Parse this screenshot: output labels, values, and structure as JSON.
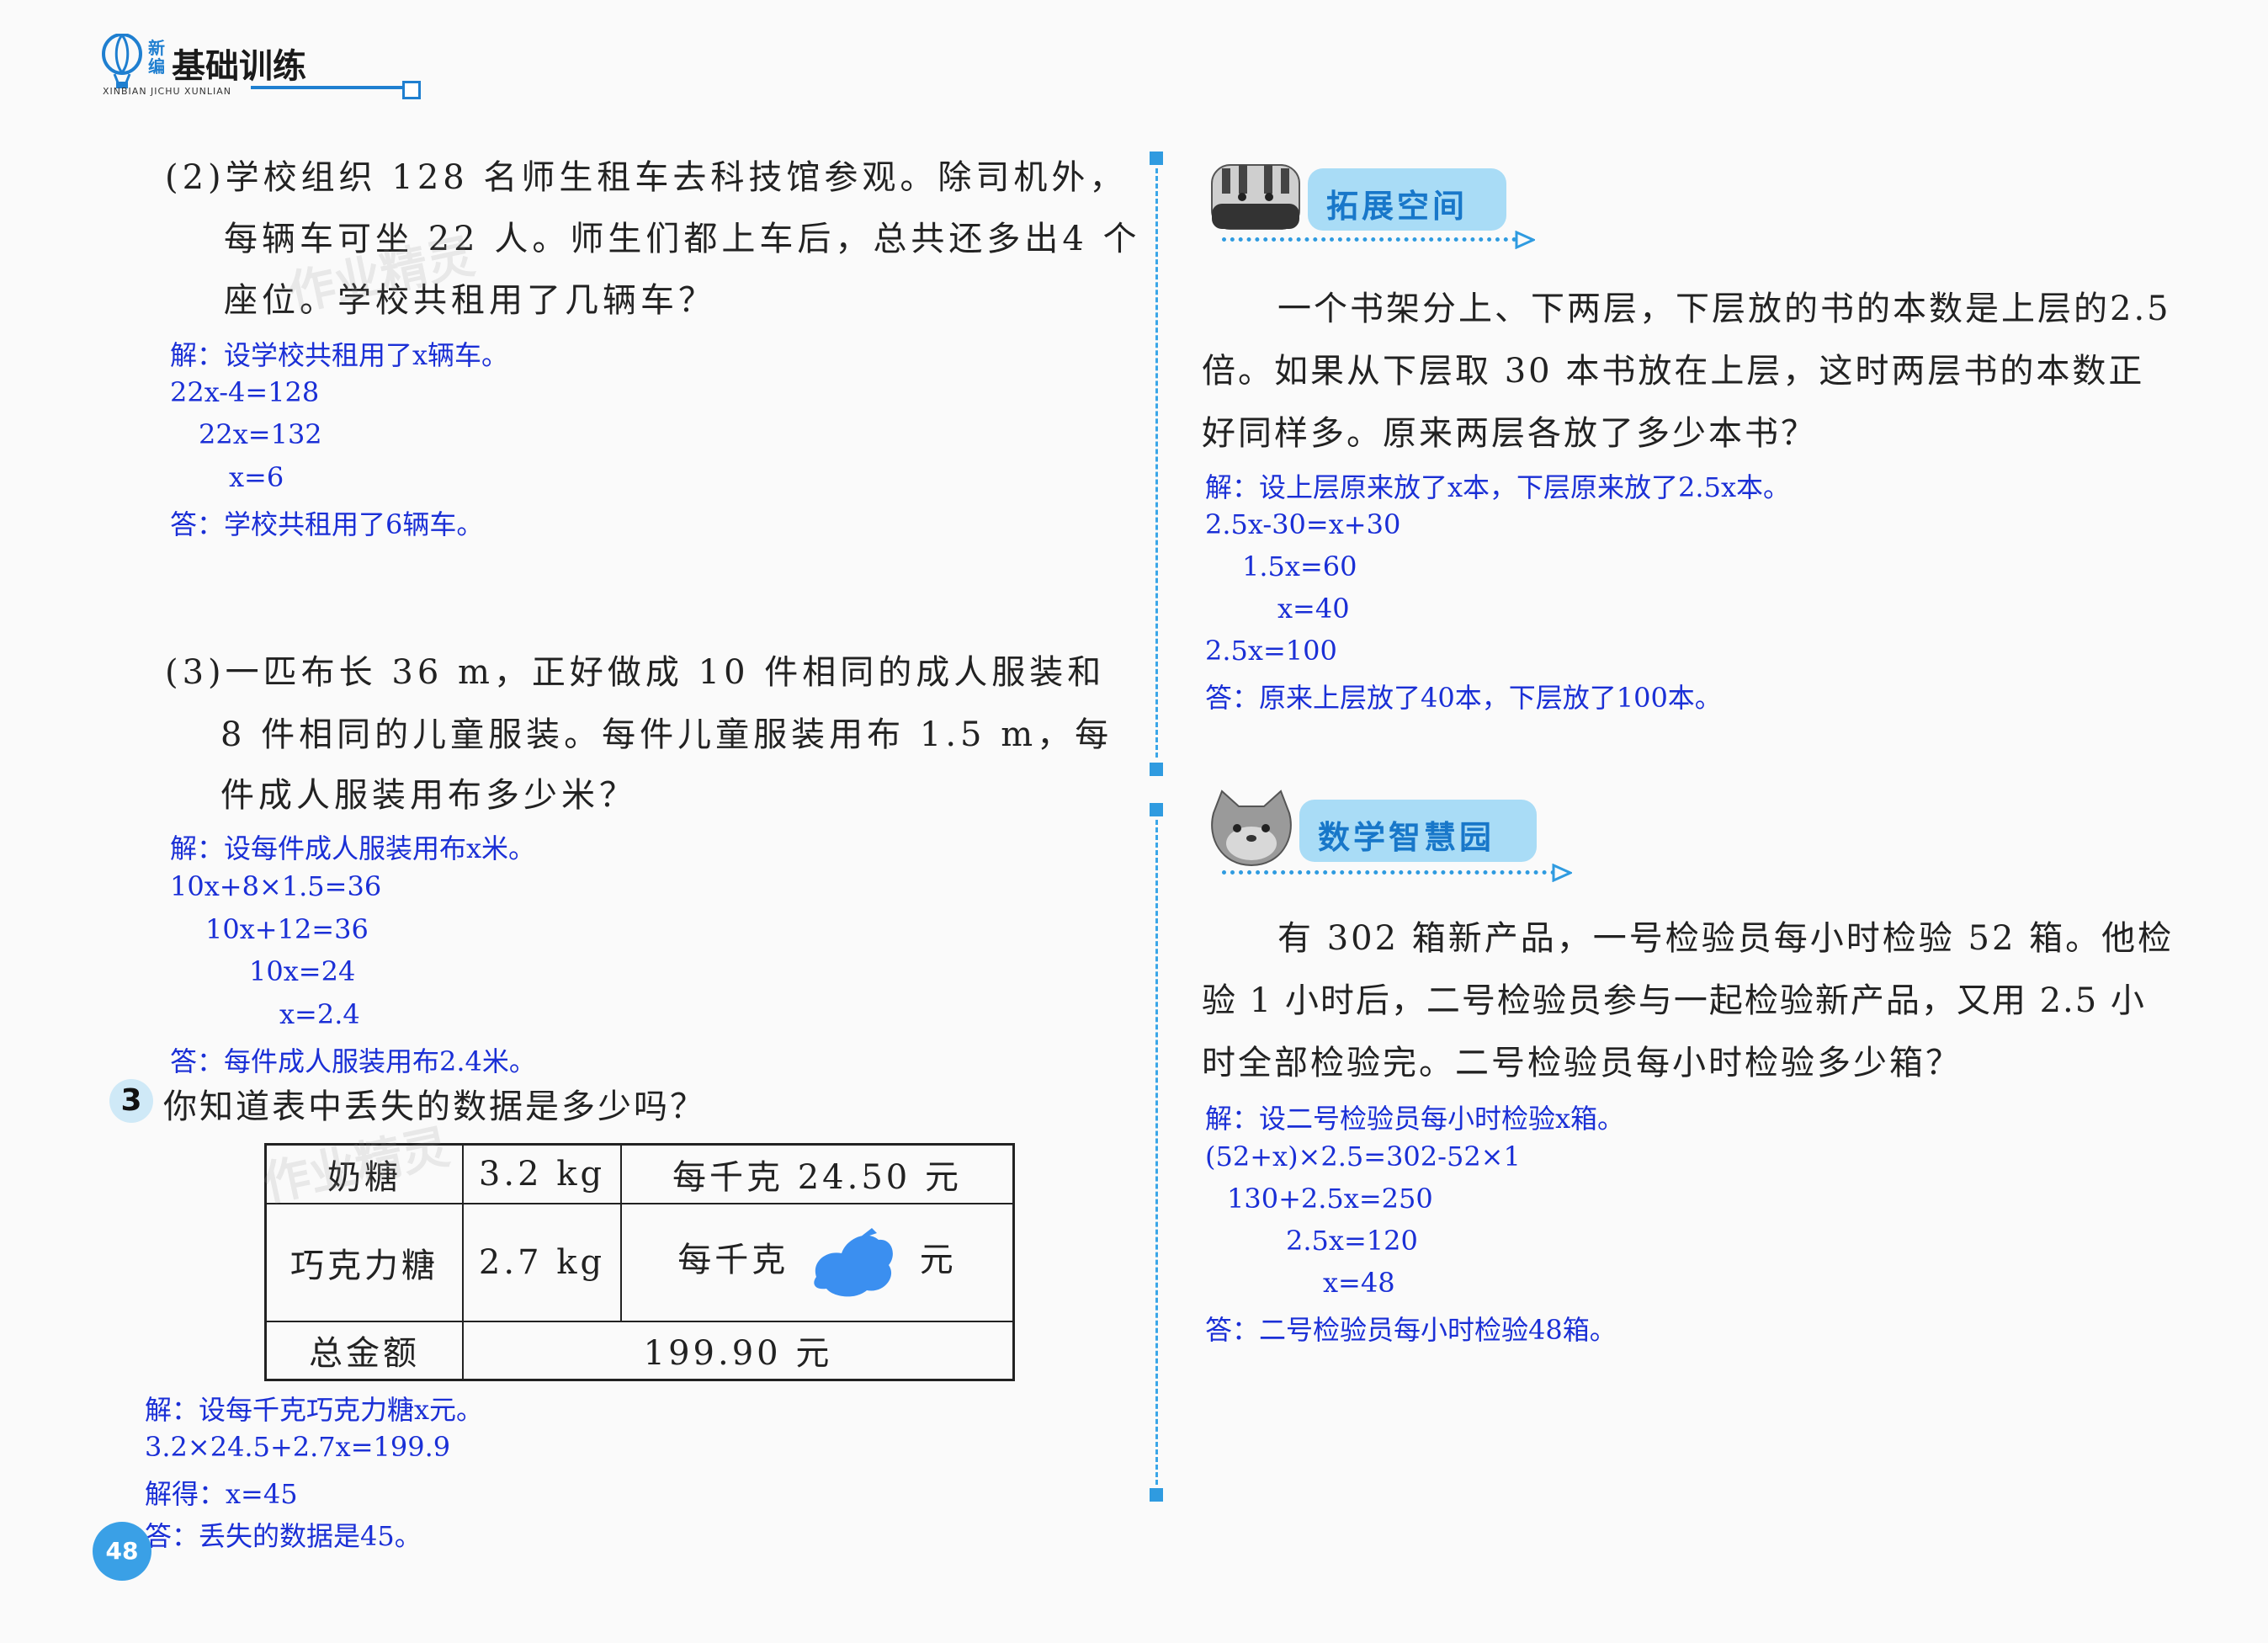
{
  "header": {
    "logo_badge": "新编",
    "title": "基础训练",
    "subtitle": "XINBIAN JICHU XUNLIAN"
  },
  "left": {
    "p2": {
      "lines": [
        "(2)学校组织 128 名师生租车去科技馆参观。除司机外，",
        "每辆车可坐 22 人。师生们都上车后，总共还多出4 个",
        "座位。学校共租用了几辆车？"
      ],
      "answer": [
        "解：设学校共租用了x辆车。",
        "22x-4=128",
        "22x=132",
        "x=6",
        "答：学校共租用了6辆车。"
      ]
    },
    "p3": {
      "lines": [
        "(3)一匹布长 36 m，正好做成 10 件相同的成人服装和",
        "8 件相同的儿童服装。每件儿童服装用布 1.5 m，每",
        "件成人服装用布多少米？"
      ],
      "answer": [
        "解：设每件成人服装用布x米。",
        "10x+8×1.5=36",
        "10x+12=36",
        "10x=24",
        "x=2.4",
        "答：每件成人服装用布2.4米。"
      ]
    },
    "q3": {
      "number": "3",
      "prompt": "你知道表中丢失的数据是多少吗？",
      "table": {
        "rows": [
          [
            "奶糖",
            "3.2 kg",
            "每千克 24.50 元"
          ],
          [
            "巧克力糖",
            "2.7 kg",
            "每千克",
            "元"
          ],
          [
            "总金额",
            "199.90 元"
          ]
        ]
      },
      "answer": [
        "解：设每千克巧克力糖x元。",
        "3.2×24.5+2.7x=199.9",
        "解得：x=45",
        "答：丢失的数据是45。"
      ]
    },
    "page_number": "48"
  },
  "right": {
    "expand": {
      "title": "拓展空间",
      "lines": [
        "一个书架分上、下两层，下层放的书的本数是上层的2.5",
        "倍。如果从下层取 30 本书放在上层，这时两层书的本数正",
        "好同样多。原来两层各放了多少本书？"
      ],
      "answer": [
        "解：设上层原来放了x本，下层原来放了2.5x本。",
        "2.5x-30=x+30",
        "1.5x=60",
        "x=40",
        "2.5x=100",
        "答：原来上层放了40本，下层放了100本。"
      ]
    },
    "wisdom": {
      "title": "数学智慧园",
      "lines": [
        "有 302 箱新产品，一号检验员每小时检验 52 箱。他检",
        "验 1 小时后，二号检验员参与一起检验新产品，又用 2.5 小",
        "时全部检验完。二号检验员每小时检验多少箱？"
      ],
      "answer": [
        "解：设二号检验员每小时检验x箱。",
        "(52+x)×2.5=302-52×1",
        "130+2.5x=250",
        "2.5x=120",
        "x=48",
        "答：二号检验员每小时检验48箱。"
      ]
    }
  },
  "watermark": "作业精灵",
  "colors": {
    "answer_blue": "#1a2fd6",
    "accent_blue": "#2f9be0",
    "title_blue": "#1877c9"
  }
}
